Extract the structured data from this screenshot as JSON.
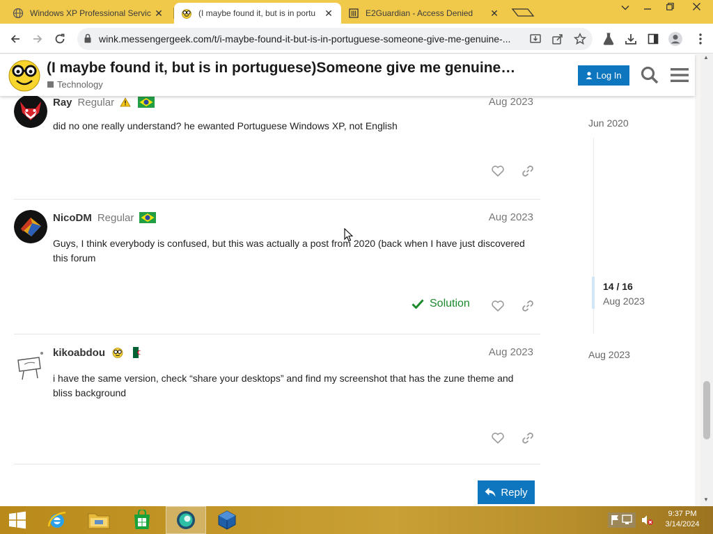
{
  "browser": {
    "tabs": [
      {
        "label": "Windows XP Professional Servic",
        "close": "✕"
      },
      {
        "label": "(I maybe found it, but is in portu",
        "close": "✕"
      },
      {
        "label": "E2Guardian - Access Denied",
        "close": "✕"
      }
    ],
    "url": "wink.messengergeek.com/t/i-maybe-found-it-but-is-in-portuguese-someone-give-me-genuine-..."
  },
  "site": {
    "topic_title": "(I maybe found it, but is in portuguese)Someone give me genuine…",
    "category": "Technology",
    "login_label": "Log In"
  },
  "posts": [
    {
      "username": "Ray",
      "title": "Regular",
      "date": "Aug 2023",
      "text": "did no one really understand? he ewanted Portuguese Windows XP, not English"
    },
    {
      "username": "NicoDM",
      "title": "Regular",
      "date": "Aug 2023",
      "text": "Guys, I think everybody is confused, but this was actually a post from 2020 (back when I have just discovered this forum",
      "solution_label": "Solution"
    },
    {
      "username": "kikoabdou",
      "date": "Aug 2023",
      "text": "i have the same version, check “share your desktops” and find my screenshot that has the zune theme and bliss background"
    }
  ],
  "reply_label": "Reply",
  "timeline": {
    "start": "Jun 2020",
    "position": "14 / 16",
    "position_date": "Aug 2023",
    "end": "Aug 2023"
  },
  "taskbar": {
    "time": "9:37 PM",
    "date": "3/14/2024"
  },
  "colors": {
    "accent": "#0e76bf",
    "solution": "#1b8a2c",
    "tabstrip": "#f0c84a"
  }
}
